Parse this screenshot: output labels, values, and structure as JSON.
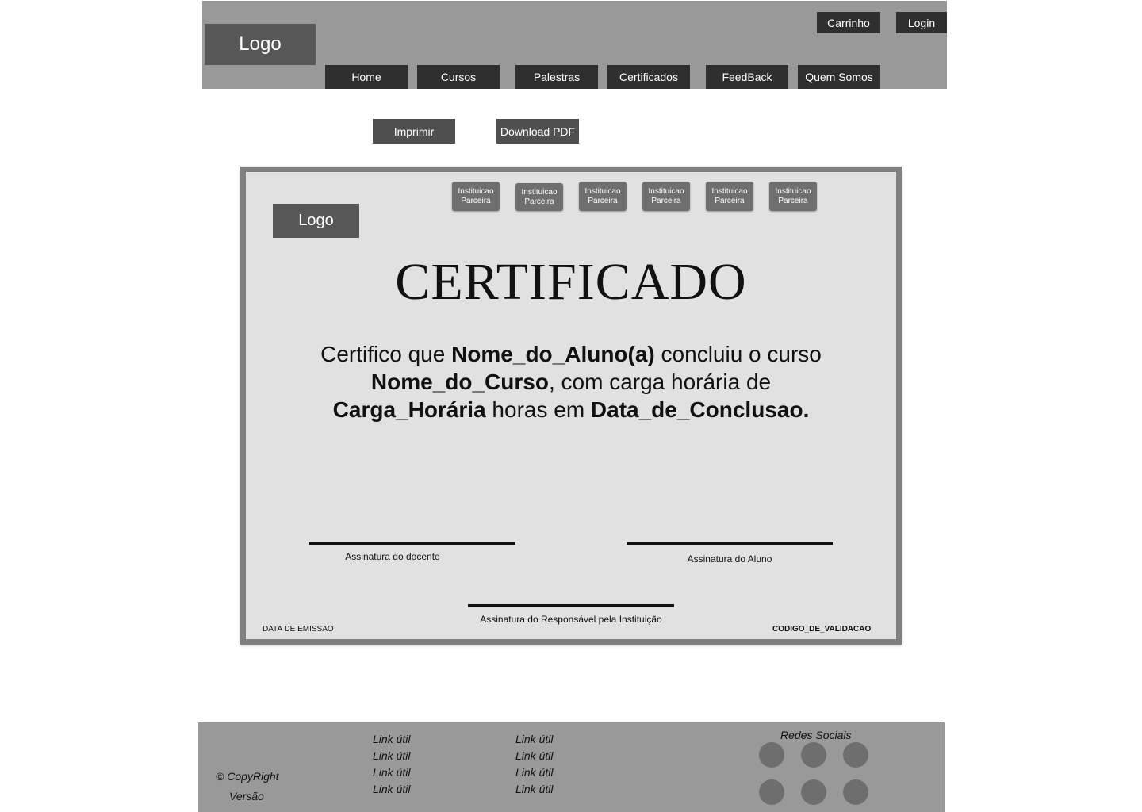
{
  "header": {
    "logo": "Logo",
    "cart_label": "Carrinho",
    "login_label": "Login",
    "nav": [
      "Home",
      "Cursos",
      "Palestras",
      "Certificados",
      "FeedBack",
      "Quem Somos"
    ]
  },
  "actions": {
    "print_label": "Imprimir",
    "download_label": "Download PDF"
  },
  "certificate": {
    "logo": "Logo",
    "partner_label": "Instituicao Parceira",
    "title": "CERTIFICADO",
    "body": {
      "t1": "Certifico que ",
      "student": "Nome_do_Aluno(a)",
      "t2": " concluiu o curso ",
      "course": "Nome_do_Curso",
      "t3": ", com carga horária de ",
      "hours": "Carga_Horária",
      "t4": " horas em ",
      "date": "Data_de_Conclusao."
    },
    "signature_teacher": "Assinatura do docente",
    "signature_student": "Assinatura do Aluno",
    "signature_institution": "Assinatura do Responsável pela Instituição",
    "issue_date_label": "DATA DE EMISSAO",
    "validation_code": "CODIGO_DE_VALIDACAO"
  },
  "footer": {
    "copyright": "© CopyRight",
    "version": "Versão",
    "link_label": "Link útil",
    "social_title": "Redes Sociais"
  },
  "colors": {
    "header_bg": "#999999",
    "nav_bg": "#2f2f2f",
    "certificate_bg": "#e1e1e1",
    "certificate_border": "#7f7f7f"
  }
}
